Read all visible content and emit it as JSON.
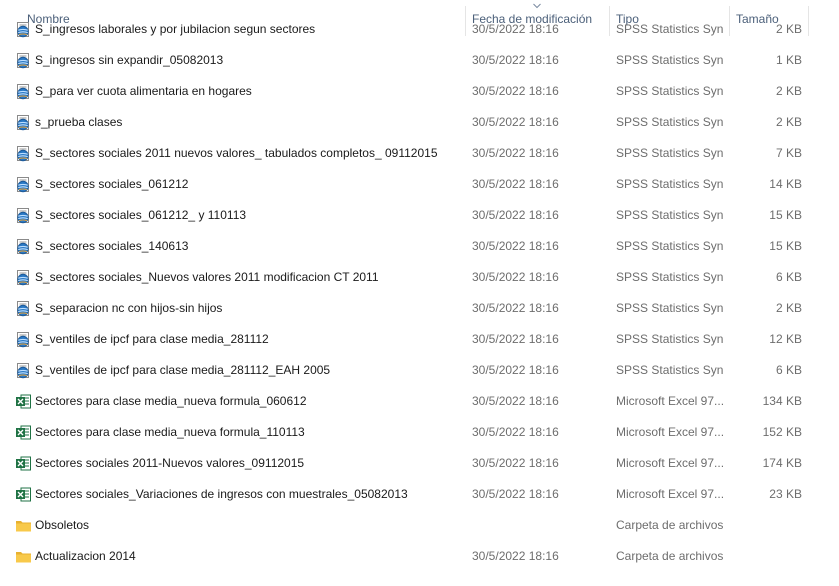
{
  "columns": {
    "name": "Nombre",
    "date": "Fecha de modificación",
    "type": "Tipo",
    "size": "Tamaño"
  },
  "rows": [
    {
      "name": "S_ingresos laborales y por jubilacion segun sectores",
      "date": "30/5/2022 18:16",
      "type": "SPSS Statistics Syn...",
      "size": "2 KB",
      "icon": "spss-syntax-icon"
    },
    {
      "name": "S_ingresos sin expandir_05082013",
      "date": "30/5/2022 18:16",
      "type": "SPSS Statistics Syn...",
      "size": "1 KB",
      "icon": "spss-syntax-icon"
    },
    {
      "name": "S_para ver cuota alimentaria en hogares",
      "date": "30/5/2022 18:16",
      "type": "SPSS Statistics Syn...",
      "size": "2 KB",
      "icon": "spss-syntax-icon"
    },
    {
      "name": "s_prueba clases",
      "date": "30/5/2022 18:16",
      "type": "SPSS Statistics Syn...",
      "size": "2 KB",
      "icon": "spss-syntax-icon"
    },
    {
      "name": "S_sectores sociales 2011 nuevos valores_ tabulados completos_ 09112015",
      "date": "30/5/2022 18:16",
      "type": "SPSS Statistics Syn...",
      "size": "7 KB",
      "icon": "spss-syntax-icon"
    },
    {
      "name": "S_sectores sociales_061212",
      "date": "30/5/2022 18:16",
      "type": "SPSS Statistics Syn...",
      "size": "14 KB",
      "icon": "spss-syntax-icon"
    },
    {
      "name": "S_sectores sociales_061212_ y 110113",
      "date": "30/5/2022 18:16",
      "type": "SPSS Statistics Syn...",
      "size": "15 KB",
      "icon": "spss-syntax-icon"
    },
    {
      "name": "S_sectores sociales_140613",
      "date": "30/5/2022 18:16",
      "type": "SPSS Statistics Syn...",
      "size": "15 KB",
      "icon": "spss-syntax-icon"
    },
    {
      "name": "S_sectores sociales_Nuevos valores 2011 modificacion CT 2011",
      "date": "30/5/2022 18:16",
      "type": "SPSS Statistics Syn...",
      "size": "6 KB",
      "icon": "spss-syntax-icon"
    },
    {
      "name": "S_separacion nc con hijos-sin hijos",
      "date": "30/5/2022 18:16",
      "type": "SPSS Statistics Syn...",
      "size": "2 KB",
      "icon": "spss-syntax-icon"
    },
    {
      "name": "S_ventiles de ipcf para clase media_281112",
      "date": "30/5/2022 18:16",
      "type": "SPSS Statistics Syn...",
      "size": "12 KB",
      "icon": "spss-syntax-icon"
    },
    {
      "name": "S_ventiles de ipcf para clase media_281112_EAH 2005",
      "date": "30/5/2022 18:16",
      "type": "SPSS Statistics Syn...",
      "size": "6 KB",
      "icon": "spss-syntax-icon"
    },
    {
      "name": "Sectores para clase media_nueva formula_060612",
      "date": "30/5/2022 18:16",
      "type": "Microsoft Excel 97...",
      "size": "134 KB",
      "icon": "excel-icon"
    },
    {
      "name": "Sectores para clase media_nueva formula_110113",
      "date": "30/5/2022 18:16",
      "type": "Microsoft Excel 97...",
      "size": "152 KB",
      "icon": "excel-icon"
    },
    {
      "name": "Sectores sociales 2011-Nuevos valores_09112015",
      "date": "30/5/2022 18:16",
      "type": "Microsoft Excel 97...",
      "size": "174 KB",
      "icon": "excel-icon"
    },
    {
      "name": "Sectores sociales_Variaciones de ingresos con muestrales_05082013",
      "date": "30/5/2022 18:16",
      "type": "Microsoft Excel 97...",
      "size": "23 KB",
      "icon": "excel-icon"
    },
    {
      "name": "Obsoletos",
      "date": "",
      "type": "Carpeta de archivos",
      "size": "",
      "icon": "folder-icon"
    },
    {
      "name": "Actualizacion 2014",
      "date": "30/5/2022 18:16",
      "type": "Carpeta de archivos",
      "size": "",
      "icon": "folder-icon"
    }
  ],
  "colors": {
    "header_text": "#4c607a",
    "secondary_text": "#6d6d6d",
    "excel_green": "#1f7244",
    "folder_yellow": "#f8c94a",
    "spss_blue": "#2a78c4"
  }
}
